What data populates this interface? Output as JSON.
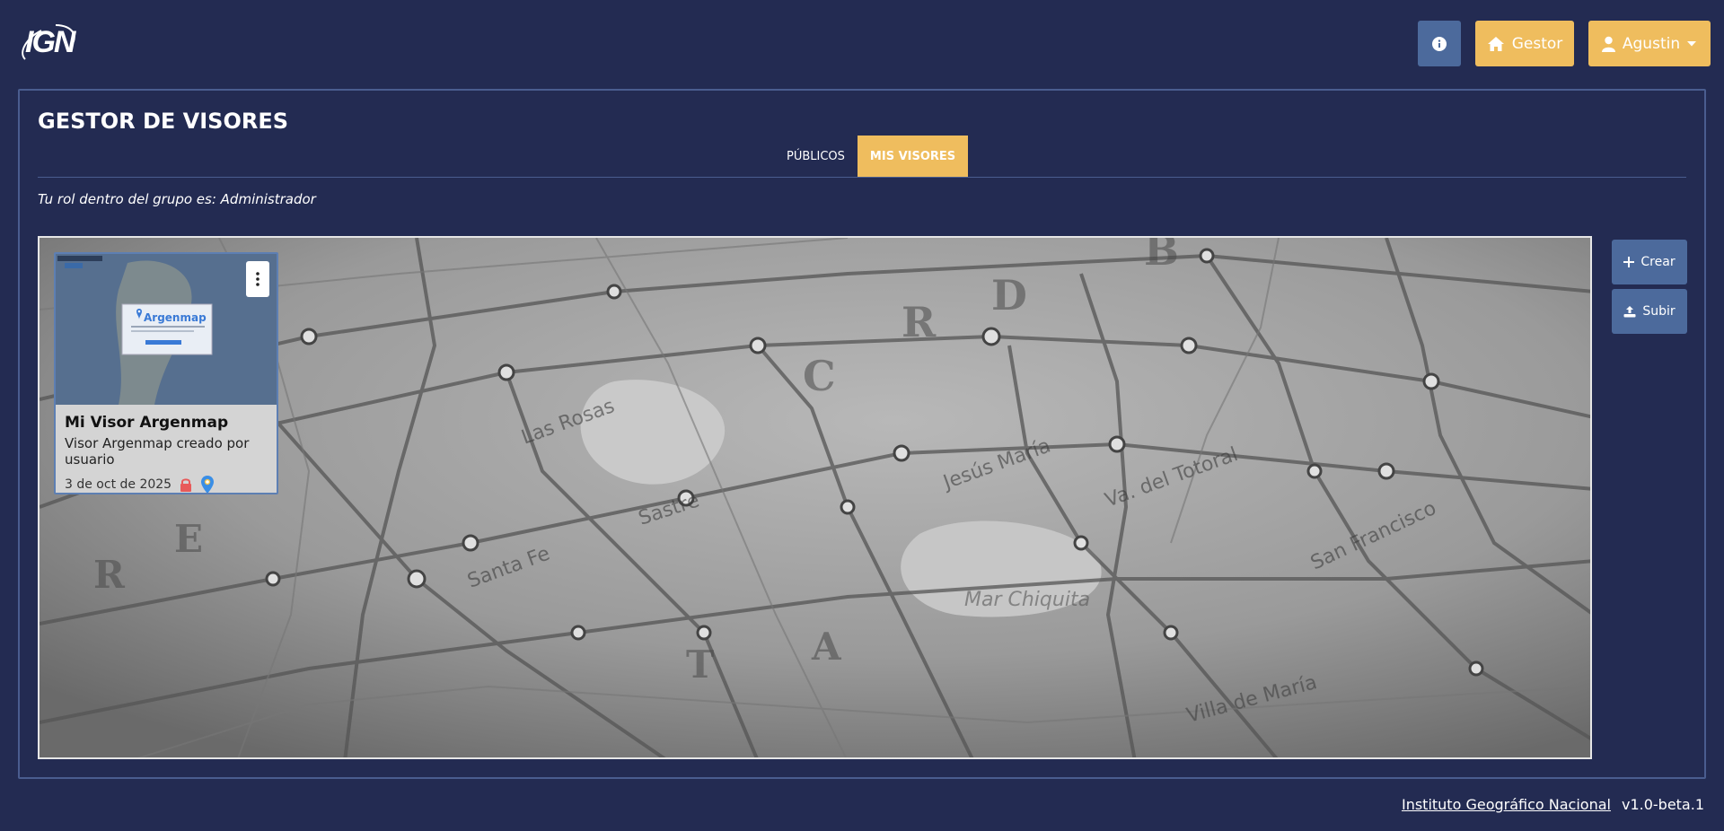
{
  "header": {
    "logo_text": "IGN",
    "info_icon": "info-circle-icon",
    "gestor_label": "Gestor",
    "user_label": "Agustin"
  },
  "page": {
    "title": "GESTOR DE VISORES",
    "tabs": [
      {
        "label": "PÚBLICOS",
        "active": false
      },
      {
        "label": "MIS VISORES",
        "active": true
      }
    ],
    "role_text": "Tu rol dentro del grupo es: Administrador"
  },
  "card": {
    "thumb_brand": "Argenmap",
    "title": "Mi Visor Argenmap",
    "description": "Visor Argenmap creado por usuario",
    "date": "3 de oct de 2025",
    "icons": [
      "lock-icon",
      "map-pin-icon"
    ]
  },
  "actions": {
    "crear_label": "Crear",
    "subir_label": "Subir"
  },
  "footer": {
    "link_label": "Instituto Geográfico Nacional",
    "version": "v1.0-beta.1"
  },
  "colors": {
    "background": "#232b52",
    "accent": "#efbd5e",
    "button_blue": "#4c6a9c",
    "border": "#4a5d8f"
  }
}
